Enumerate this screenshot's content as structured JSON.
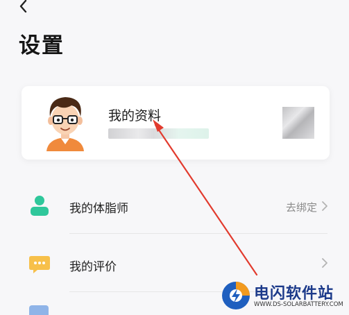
{
  "header": {
    "back_icon": "chevron-left-icon",
    "title": "设置"
  },
  "profile": {
    "name": "我的资料",
    "avatar_icon": "cartoon-avatar-icon"
  },
  "list": {
    "items": [
      {
        "label": "我的体脂师",
        "value": "去绑定",
        "icon": "person-icon",
        "icon_color": "#2fc79b"
      },
      {
        "label": "我的评价",
        "value": "",
        "icon": "comment-icon",
        "icon_color": "#f7c04a"
      }
    ]
  },
  "watermark": {
    "title": "电闪软件站",
    "subtitle": "WWW.DS-SOLARBATTERY.COM"
  },
  "colors": {
    "annotation_arrow": "#e23b2e",
    "accent_green": "#2fc79b",
    "accent_yellow": "#f7c04a"
  }
}
